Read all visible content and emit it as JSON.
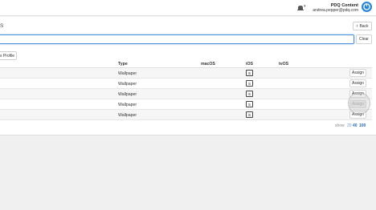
{
  "header": {
    "title": "PDQ Content",
    "email": "andrea.pepper@pdq.com",
    "bell_icon": "bell-icon",
    "logo_icon": "power-icon",
    "accent": "#2a86d6"
  },
  "page": {
    "title_fragment": "S",
    "back_label": "Back",
    "clear_label": "Clear",
    "search_value": "",
    "profile_button_fragment": "s Profile"
  },
  "table": {
    "columns": {
      "type": "Type",
      "macos": "macOS",
      "ios": "iOS",
      "tvos": "tvOS"
    },
    "rows": [
      {
        "type": "Wallpaper",
        "ios": "S",
        "action": "Assign"
      },
      {
        "type": "Wallpaper",
        "ios": "S",
        "action": "Assign"
      },
      {
        "type": "Wallpaper",
        "ios": "S",
        "action": "Assign"
      },
      {
        "type": "Wallpaper",
        "ios": "S",
        "action": "Assign"
      },
      {
        "type": "Wallpaper",
        "ios": "S",
        "action": "Assign"
      }
    ]
  },
  "pagination": {
    "show_label": "show",
    "options": [
      "20",
      "40",
      "100"
    ]
  }
}
